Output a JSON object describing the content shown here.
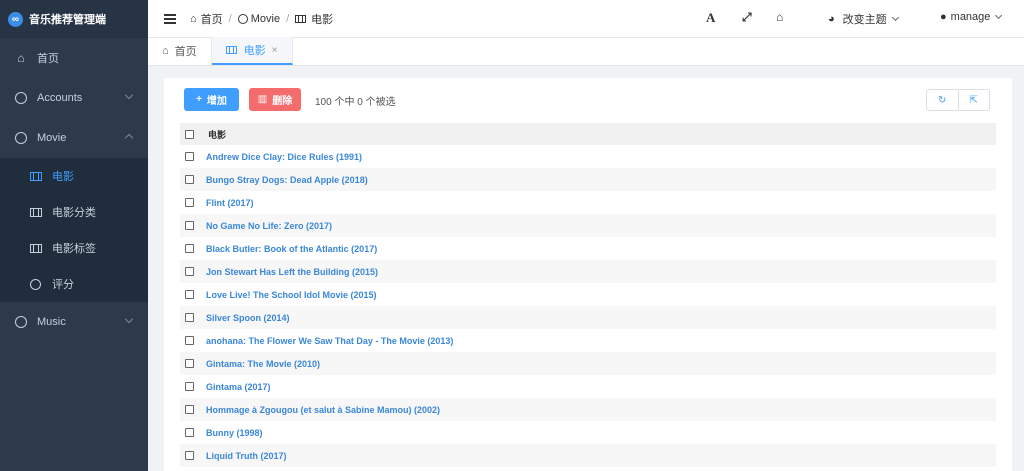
{
  "sidebar": {
    "brand": "音乐推荐管理端",
    "items": [
      {
        "label": "首页"
      },
      {
        "label": "Accounts"
      },
      {
        "label": "Movie"
      },
      {
        "label": "Music"
      }
    ],
    "movie_sub": [
      {
        "label": "电影"
      },
      {
        "label": "电影分类"
      },
      {
        "label": "电影标签"
      },
      {
        "label": "评分"
      }
    ]
  },
  "header": {
    "breadcrumb": [
      "首页",
      "Movie",
      "电影"
    ],
    "font_label": "A",
    "theme_label": "改变主题",
    "user_label": "manage"
  },
  "tabs": [
    {
      "label": "首页"
    },
    {
      "label": "电影",
      "close": "×"
    }
  ],
  "toolbar": {
    "add_label": "增加",
    "delete_label": "删除",
    "selection_info": "100 个中 0 个被选"
  },
  "table": {
    "header": "电影",
    "rows": [
      "Andrew Dice Clay: Dice Rules (1991)",
      "Bungo Stray Dogs: Dead Apple (2018)",
      "Flint (2017)",
      "No Game No Life: Zero (2017)",
      "Black Butler: Book of the Atlantic (2017)",
      "Jon Stewart Has Left the Building (2015)",
      "Love Live! The School Idol Movie (2015)",
      "Silver Spoon (2014)",
      "anohana: The Flower We Saw That Day - The Movie (2013)",
      "Gintama: The Movie (2010)",
      "Gintama (2017)",
      "Hommage à Zgougou (et salut à Sabine Mamou) (2002)",
      "Bunny (1998)",
      "Liquid Truth (2017)"
    ]
  },
  "colors": {
    "accent": "#409eff",
    "danger": "#f56c6c",
    "sidebar": "#2d3a4b"
  }
}
